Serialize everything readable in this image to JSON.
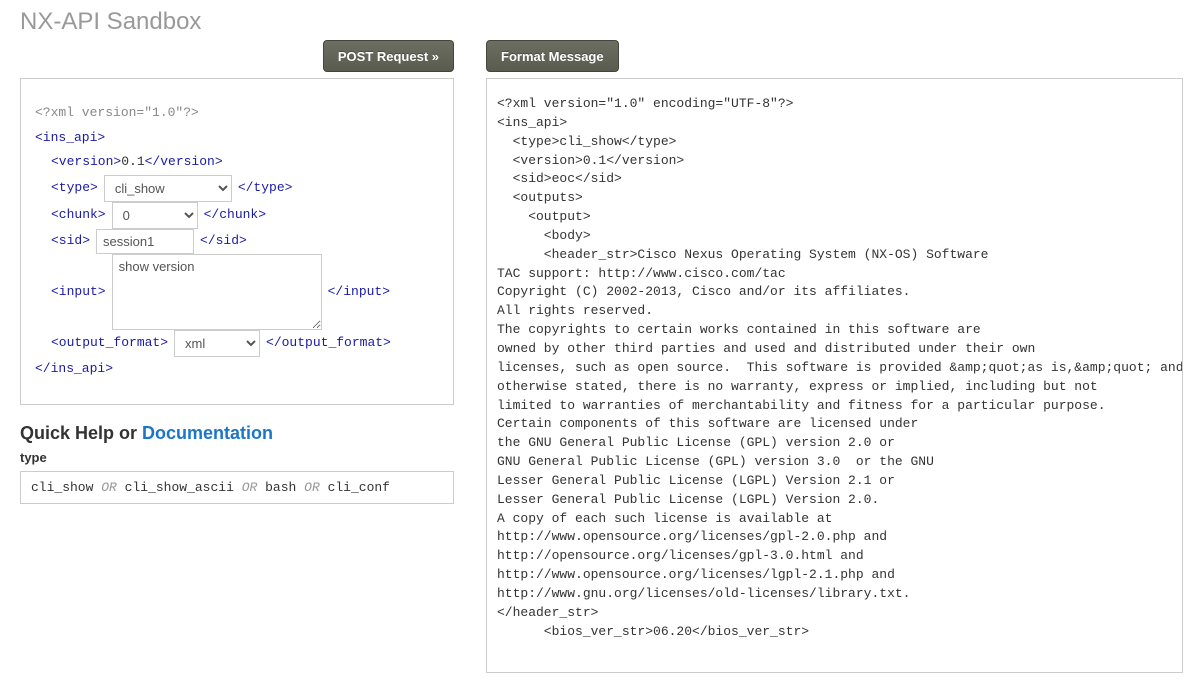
{
  "page": {
    "title": "NX-API Sandbox"
  },
  "buttons": {
    "post": "POST Request »",
    "format": "Format Message"
  },
  "request": {
    "xml_decl": "<?xml version=\"1.0\"?>",
    "root_open": "<ins_api>",
    "root_close": "</ins_api>",
    "version_open": "<version>",
    "version_val": "0.1",
    "version_close": "</version>",
    "type_open": "<type>",
    "type_close": "</type>",
    "type_options": [
      "cli_show"
    ],
    "type_selected": "cli_show",
    "chunk_open": "<chunk>",
    "chunk_close": "</chunk>",
    "chunk_options": [
      "0"
    ],
    "chunk_selected": "0",
    "sid_open": "<sid>",
    "sid_close": "</sid>",
    "sid_value": "session1",
    "input_open": "<input>",
    "input_close": "</input>",
    "input_value": "show version",
    "of_open": "<output_format>",
    "of_close": "</output_format>",
    "of_options": [
      "xml"
    ],
    "of_selected": "xml"
  },
  "response": {
    "text": "<?xml version=\"1.0\" encoding=\"UTF-8\"?>\n<ins_api>\n  <type>cli_show</type>\n  <version>0.1</version>\n  <sid>eoc</sid>\n  <outputs>\n    <output>\n      <body>\n      <header_str>Cisco Nexus Operating System (NX-OS) Software\nTAC support: http://www.cisco.com/tac\nCopyright (C) 2002-2013, Cisco and/or its affiliates.\nAll rights reserved.\nThe copyrights to certain works contained in this software are\nowned by other third parties and used and distributed under their own\nlicenses, such as open source.  This software is provided &amp;quot;as is,&amp;quot; and unless\notherwise stated, there is no warranty, express or implied, including but not\nlimited to warranties of merchantability and fitness for a particular purpose.\nCertain components of this software are licensed under\nthe GNU General Public License (GPL) version 2.0 or\nGNU General Public License (GPL) version 3.0  or the GNU\nLesser General Public License (LGPL) Version 2.1 or\nLesser General Public License (LGPL) Version 2.0.\nA copy of each such license is available at\nhttp://www.opensource.org/licenses/gpl-2.0.php and\nhttp://opensource.org/licenses/gpl-3.0.html and\nhttp://www.opensource.org/licenses/lgpl-2.1.php and\nhttp://www.gnu.org/licenses/old-licenses/library.txt.\n</header_str>\n      <bios_ver_str>06.20</bios_ver_str>"
  },
  "help": {
    "heading_prefix": "Quick Help or ",
    "heading_link": "Documentation",
    "type_label": "type",
    "type_opts": [
      "cli_show",
      "cli_show_ascii",
      "bash",
      "cli_conf"
    ],
    "or": "OR"
  }
}
